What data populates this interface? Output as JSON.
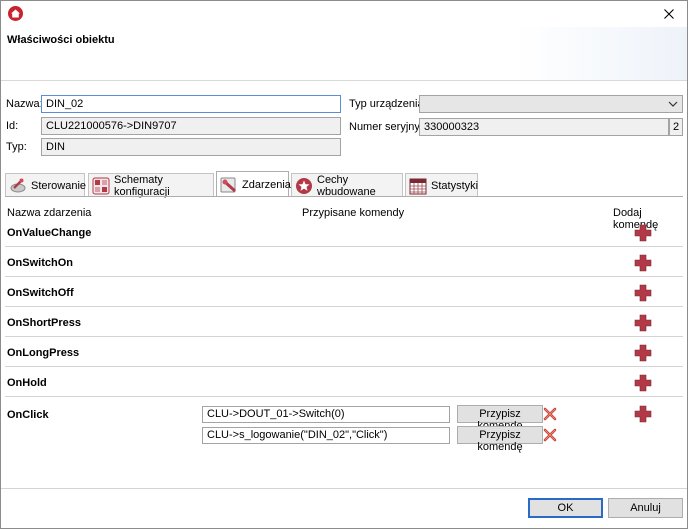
{
  "window": {
    "dialog_title": "Właściwości obiektu"
  },
  "form": {
    "name_label": "Nazwa:",
    "name_value": "DIN_02",
    "id_label": "Id:",
    "id_value": "CLU221000576->DIN9707",
    "type_label": "Typ:",
    "type_value": "DIN",
    "device_type_label": "Typ urządzenia:",
    "device_type_value": "",
    "serial_label": "Numer seryjny:",
    "serial_value": "330000323",
    "serial_suffix": "2"
  },
  "tabs": [
    {
      "label": "Sterowanie",
      "icon": "control-icon"
    },
    {
      "label": "Schematy konfiguracji",
      "icon": "schema-icon"
    },
    {
      "label": "Zdarzenia",
      "icon": "events-icon"
    },
    {
      "label": "Cechy wbudowane",
      "icon": "star-icon"
    },
    {
      "label": "Statystyki",
      "icon": "calendar-icon"
    }
  ],
  "active_tab": "Zdarzenia",
  "columns": {
    "event_name": "Nazwa zdarzenia",
    "assigned_commands": "Przypisane komendy",
    "add_command": "Dodaj komendę"
  },
  "events": [
    {
      "name": "OnValueChange"
    },
    {
      "name": "OnSwitchOn"
    },
    {
      "name": "OnSwitchOff"
    },
    {
      "name": "OnShortPress"
    },
    {
      "name": "OnLongPress"
    },
    {
      "name": "OnHold"
    },
    {
      "name": "OnClick"
    }
  ],
  "onclick_commands": [
    {
      "command": "CLU->DOUT_01->Switch(0)",
      "assign_label": "Przypisz komendę"
    },
    {
      "command": "CLU->s_logowanie(\"DIN_02\",\"Click\")",
      "assign_label": "Przypisz komendę"
    }
  ],
  "footer": {
    "ok_label": "OK",
    "cancel_label": "Anuluj"
  },
  "colors": {
    "accent_blue": "#2b6bc8",
    "add_icon": "#b23a48",
    "delete_icon": "#c0392b",
    "app_icon": "#c8242c"
  }
}
